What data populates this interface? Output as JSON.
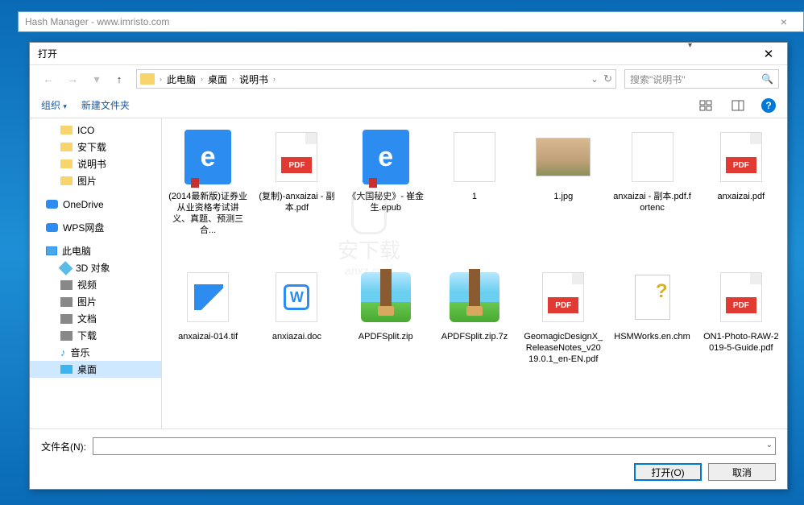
{
  "parent": {
    "title": "Hash Manager - www.imristo.com",
    "close": "×"
  },
  "dialog": {
    "title": "打开",
    "close": "✕"
  },
  "nav": {
    "back": "←",
    "forward": "→",
    "down": "▾",
    "up": "↑",
    "refresh": "↻",
    "dropdown": "⌄"
  },
  "breadcrumb": {
    "items": [
      "此电脑",
      "桌面",
      "说明书"
    ],
    "sep": "›"
  },
  "search": {
    "placeholder": "搜索\"说明书\"",
    "icon": "🔍"
  },
  "toolbar": {
    "organize": "组织",
    "organize_arrow": "▾",
    "newfolder": "新建文件夹",
    "help": "?"
  },
  "tree": [
    {
      "label": "ICO",
      "icon": "folder",
      "sub": true
    },
    {
      "label": "安下载",
      "icon": "folder",
      "sub": true
    },
    {
      "label": "说明书",
      "icon": "folder",
      "sub": true
    },
    {
      "label": "图片",
      "icon": "folder",
      "sub": true
    },
    {
      "label": "OneDrive",
      "icon": "cloud",
      "sub": false,
      "gap": true
    },
    {
      "label": "WPS网盘",
      "icon": "cloud",
      "sub": false,
      "gap": true
    },
    {
      "label": "此电脑",
      "icon": "pc",
      "sub": false,
      "gap": true
    },
    {
      "label": "3D 对象",
      "icon": "3d",
      "sub": true
    },
    {
      "label": "视频",
      "icon": "ic",
      "sub": true
    },
    {
      "label": "图片",
      "icon": "ic",
      "sub": true
    },
    {
      "label": "文档",
      "icon": "ic",
      "sub": true
    },
    {
      "label": "下载",
      "icon": "ic",
      "sub": true
    },
    {
      "label": "音乐",
      "icon": "music",
      "sub": true
    },
    {
      "label": "桌面",
      "icon": "desk",
      "sub": true,
      "sel": true
    }
  ],
  "files": [
    {
      "name": "(2014最新版)证券业从业资格考试讲义、真题、预测三合...",
      "type": "edge"
    },
    {
      "name": "(复制)-anxaizai - 副本.pdf",
      "type": "pdf"
    },
    {
      "name": "《大国秘史》- 崔金生.epub",
      "type": "edge"
    },
    {
      "name": "1",
      "type": "blank"
    },
    {
      "name": "1.jpg",
      "type": "img"
    },
    {
      "name": "anxaizai - 副本.pdf.fortenc",
      "type": "blank"
    },
    {
      "name": "anxaizai.pdf",
      "type": "pdf"
    },
    {
      "name": "anxaizai-014.tif",
      "type": "tif"
    },
    {
      "name": "anxiazai.doc",
      "type": "doc"
    },
    {
      "name": "APDFSplit.zip",
      "type": "zip"
    },
    {
      "name": "APDFSplit.zip.7z",
      "type": "zip"
    },
    {
      "name": "GeomagicDesignX_ReleaseNotes_v2019.0.1_en-EN.pdf",
      "type": "pdf"
    },
    {
      "name": "HSMWorks.en.chm",
      "type": "chm"
    },
    {
      "name": "ON1-Photo-RAW-2019-5-Guide.pdf",
      "type": "pdf"
    }
  ],
  "watermark": {
    "text": "安下载",
    "sub": "anxz.com"
  },
  "bottom": {
    "filename_label": "文件名(N):",
    "open": "打开(O)",
    "cancel": "取消"
  },
  "pdf_label": "PDF",
  "edge_letter": "e",
  "doc_letter": "W",
  "music_glyph": "♪"
}
